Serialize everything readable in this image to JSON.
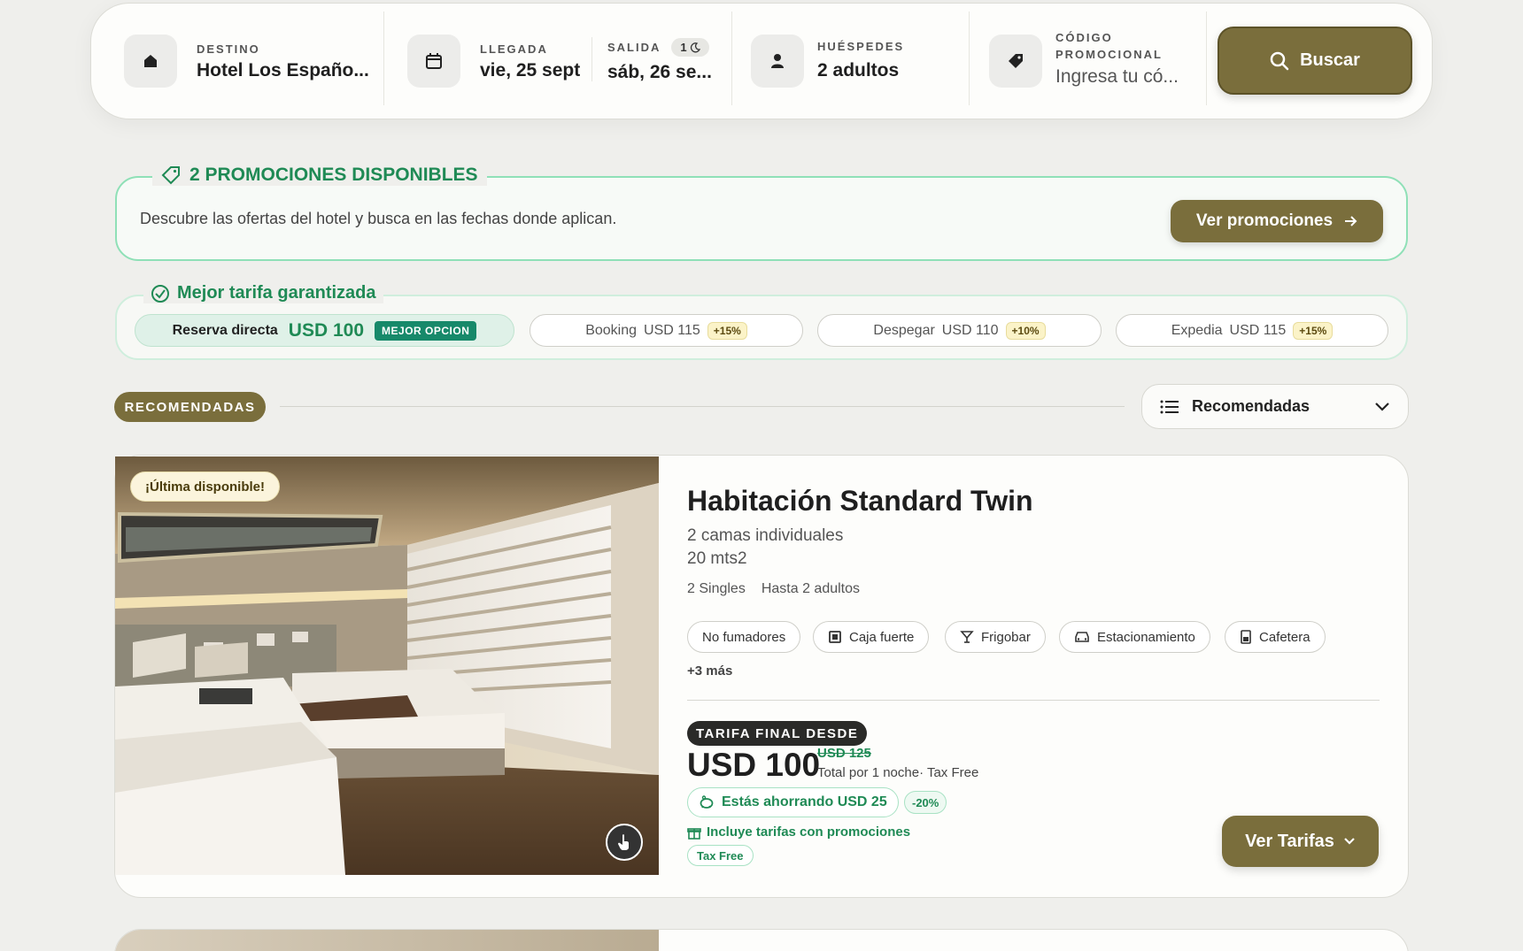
{
  "search": {
    "destination": {
      "label": "DESTINO",
      "value": "Hotel Los Españo..."
    },
    "arrival": {
      "label": "LLEGADA",
      "value": "vie, 25 sept"
    },
    "departure": {
      "label": "SALIDA",
      "value": "sáb, 26 se...",
      "nights": "1"
    },
    "guests": {
      "label": "HUÉSPEDES",
      "value": "2 adultos"
    },
    "promo_code": {
      "label_line1": "CÓDIGO",
      "label_line2": "PROMOCIONAL",
      "placeholder": "Ingresa tu có..."
    },
    "button_label": "Buscar"
  },
  "promotions": {
    "title": "2 PROMOCIONES DISPONIBLES",
    "description": "Descubre las ofertas del hotel y busca en las fechas donde aplican.",
    "button_label": "Ver promociones"
  },
  "best_rate": {
    "title": "Mejor tarifa garantizada",
    "direct": {
      "label": "Reserva directa",
      "price": "USD 100",
      "badge": "MEJOR OPCION"
    },
    "competitors": [
      {
        "name": "Booking",
        "price": "USD 115",
        "diff": "+15%"
      },
      {
        "name": "Despegar",
        "price": "USD 110",
        "diff": "+10%"
      },
      {
        "name": "Expedia",
        "price": "USD 115",
        "diff": "+15%"
      }
    ]
  },
  "listing": {
    "section_badge": "RECOMENDADAS",
    "sort_value": "Recomendadas"
  },
  "room": {
    "availability_badge": "¡Última disponible!",
    "title": "Habitación Standard Twin",
    "beds": "2 camas individuales",
    "size": "20 mts2",
    "meta": [
      "2 Singles",
      "Hasta 2 adultos"
    ],
    "amenities": [
      {
        "label": "No fumadores",
        "icon": ""
      },
      {
        "label": "Caja fuerte",
        "icon": "safe-icon"
      },
      {
        "label": "Frigobar",
        "icon": "cocktail-icon"
      },
      {
        "label": "Estacionamiento",
        "icon": "car-icon"
      },
      {
        "label": "Cafetera",
        "icon": "coffee-maker-icon"
      }
    ],
    "more": "+3 más",
    "rate_badge": "TARIFA FINAL DESDE",
    "price": "USD 100",
    "old_price": "USD 125",
    "price_note": "Total por 1 noche· Tax Free",
    "saving": "Estás ahorrando USD 25",
    "saving_pct": "-20%",
    "includes_promos": "Incluye tarifas con promociones",
    "tax_badge": "Tax Free",
    "cta_label": "Ver Tarifas"
  },
  "colors": {
    "brand": "#7a6e3c",
    "accent_green": "#1f8a55",
    "background": "#efefec"
  }
}
